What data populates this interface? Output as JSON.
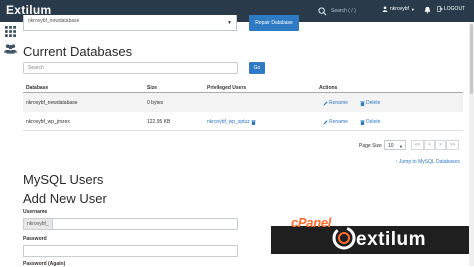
{
  "header": {
    "brand": "Extilum",
    "search_placeholder": "Search ( / )",
    "username": "nkrovybf",
    "logout_label": "LOGOUT"
  },
  "top_partial": {
    "select_value": "nkrovybf_newdatabase",
    "repair_label": "Repair Database"
  },
  "current_databases": {
    "heading": "Current Databases",
    "search_placeholder": "Search",
    "go_label": "Go",
    "columns": [
      "Database",
      "Size",
      "Privileged Users",
      "Actions"
    ],
    "rows": [
      {
        "database": "nkrovybf_newdatabase",
        "size": "0 bytes",
        "users": "",
        "rename": "Rename",
        "delete": "Delete"
      },
      {
        "database": "nkrovybf_wp_jmzex",
        "size": "122.95 KB",
        "users": "nkrovybf_wp_sptuz",
        "rename": "Rename",
        "delete": "Delete"
      }
    ],
    "page_size_label": "Page Size",
    "page_size_value": "10",
    "pager": [
      "<<",
      "<",
      ">",
      ">>"
    ],
    "jump_link": "Jump to MySQL Databases"
  },
  "mysql_users": {
    "heading": "MySQL Users",
    "subheading": "Add New User",
    "username_label": "Username",
    "username_prefix": "nkrovybf_",
    "password_label": "Password",
    "password_again_label": "Password (Again)"
  },
  "overlay": {
    "cpanel_text": "cPanel",
    "extilum_text": "extilum"
  },
  "colors": {
    "topbar": "#293a4a",
    "accent_blue": "#2e7bc4",
    "cpanel_orange": "#ff6c2c",
    "banner_black": "#1f1f1f"
  }
}
